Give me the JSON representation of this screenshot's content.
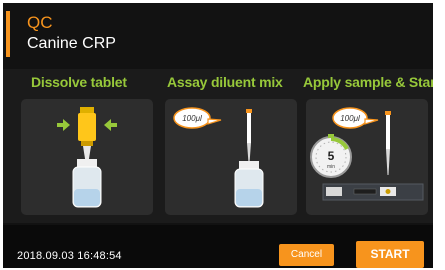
{
  "header": {
    "title": "QC",
    "subtitle": "Canine CRP"
  },
  "steps": [
    {
      "title": "Dissolve tablet",
      "icon": "tablet-vial-icon"
    },
    {
      "title": "Assay diluent mix",
      "icon": "pipette-vial-icon",
      "bubble": "100μl"
    },
    {
      "title": "Apply sample & Start",
      "icon": "pipette-timer-cartridge-icon",
      "bubble": "100μl",
      "timer_value": "5",
      "timer_unit": "min"
    }
  ],
  "footer": {
    "datetime": "2018.09.03  16:48:54",
    "cancel_label": "Cancel",
    "start_label": "START"
  },
  "colors": {
    "accent": "#f7941d",
    "step_title": "#97c83a",
    "background": "#121212",
    "panel": "#2d2d2d"
  }
}
